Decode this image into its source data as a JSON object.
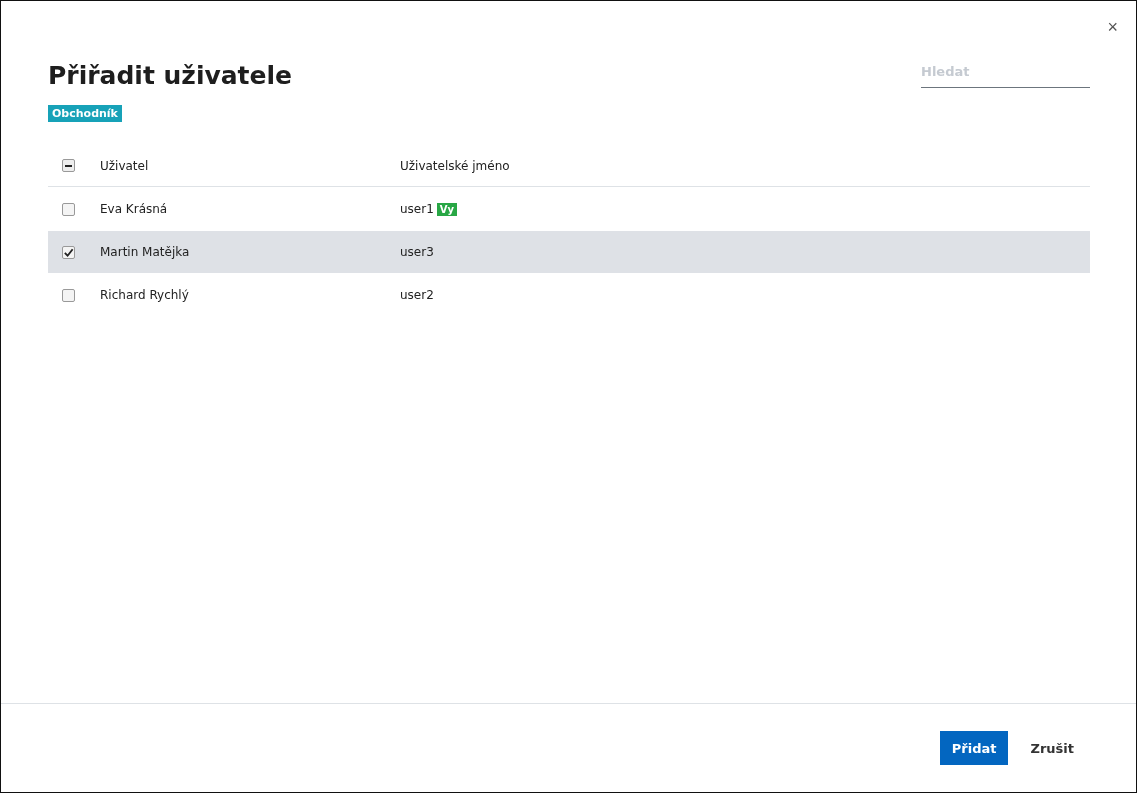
{
  "dialog": {
    "title": "Přiřadit uživatele",
    "close": "×"
  },
  "search": {
    "placeholder": "Hledat"
  },
  "role_tag": "Obchodník",
  "table": {
    "select_all": {
      "indeterminate": true
    },
    "columns": [
      "Uživatel",
      "Uživatelské jméno"
    ],
    "rows": [
      {
        "user": "Eva Krásná",
        "username": "user1",
        "badge": "Vy",
        "checked": false,
        "selected": false
      },
      {
        "user": "Martin Matějka",
        "username": "user3",
        "checked": true,
        "selected": true
      },
      {
        "user": "Richard Rychlý",
        "username": "user2",
        "checked": false,
        "selected": false
      }
    ]
  },
  "buttons": [
    {
      "label": "Přidat",
      "kind": "primary"
    },
    {
      "label": "Zrušit",
      "kind": "link"
    }
  ]
}
